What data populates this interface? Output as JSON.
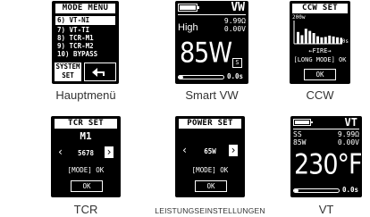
{
  "captions": {
    "main_menu": "Hauptmenü",
    "smart_vw": "Smart VW",
    "ccw": "CCW",
    "tcr": "TCR",
    "power": "LEISTUNGSEINSTELLUNGEN",
    "vt": "VT"
  },
  "mode_menu": {
    "title": "MODE MENU",
    "items": [
      "6) VT-NI",
      "7) VT-TI",
      "8) TCR-M1",
      "9) TCR-M2",
      "10) BYPASS"
    ],
    "selected_index": 0,
    "system_label_1": "SYSTEM",
    "system_label_2": "SET",
    "back_icon": "back-arrow-icon"
  },
  "smart_vw": {
    "mode": "VW",
    "level": "High",
    "resistance": "9.99Ω",
    "voltage": "0.00V",
    "power": "85W",
    "badge": "S",
    "time": "0.0s",
    "battery_fraction": 1.0,
    "progress_fraction": 0.1
  },
  "ccw": {
    "title": "CCW SET",
    "top_label": "200w",
    "right_label": "0s",
    "fire_label": "←FIRE→",
    "long_mode": "[LONG MODE] OK",
    "ok": "OK",
    "bars": [
      0.55,
      0.4,
      0.7,
      0.6,
      0.5,
      0.35,
      0.3,
      0.32,
      0.38,
      0.34,
      0.3,
      0.28
    ]
  },
  "tcr": {
    "title": "TCR SET",
    "mode": "M1",
    "value": "5678",
    "mode_ok": "[MODE] OK",
    "ok": "OK"
  },
  "power_set": {
    "title": "POWER SET",
    "value": "65W",
    "mode_ok": "[MODE] OK",
    "ok": "OK"
  },
  "vt": {
    "mode": "VT",
    "material": "SS",
    "resistance": "9.99Ω",
    "power": "85W",
    "voltage": "0.00V",
    "temp": "230°F",
    "time": "0.0s",
    "battery_fraction": 1.0,
    "progress_fraction": 0.1
  },
  "colors": {
    "screen": "#000000",
    "text": "#ffffff",
    "caption": "#333333"
  }
}
